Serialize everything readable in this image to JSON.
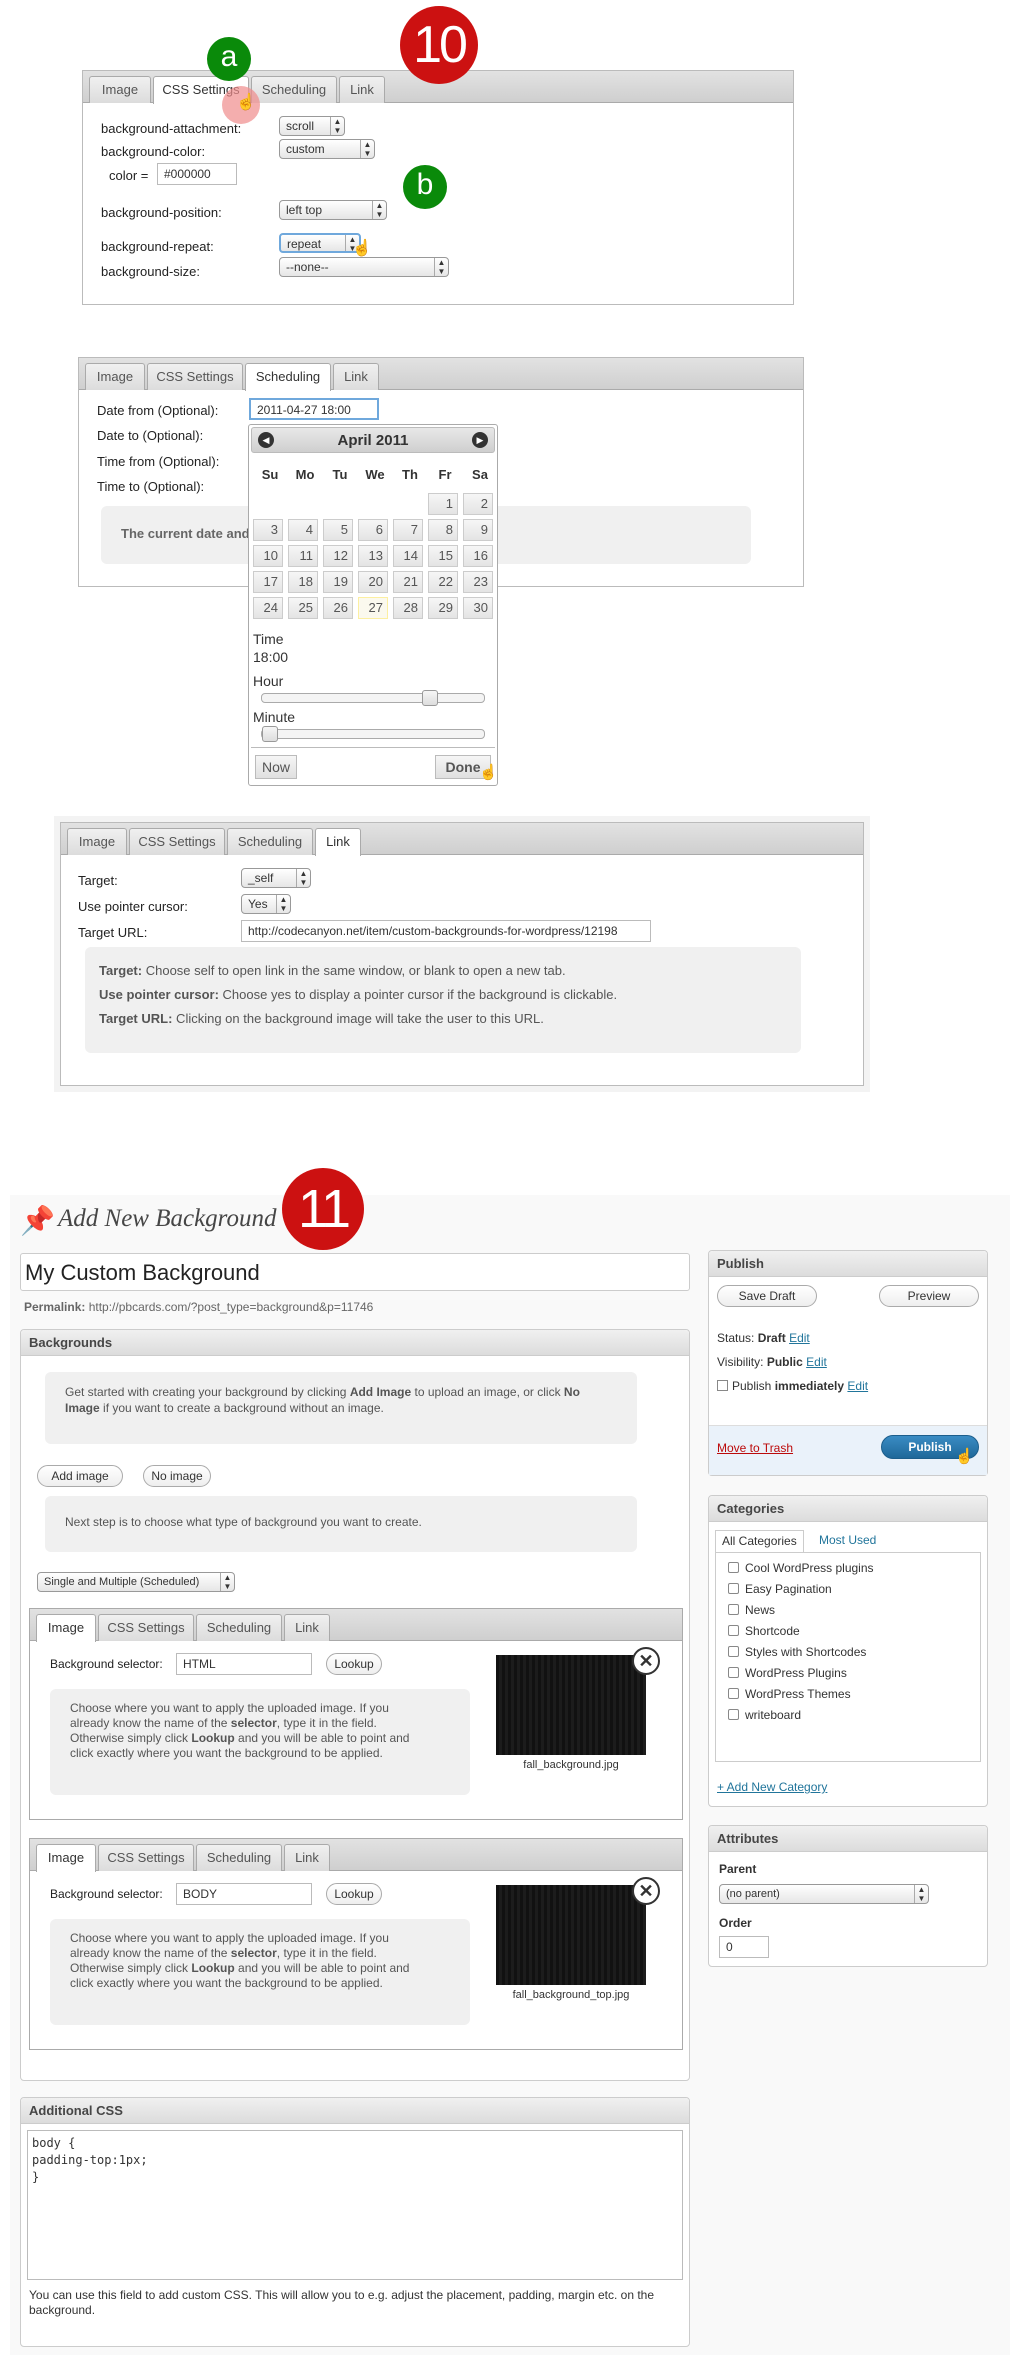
{
  "callouts": {
    "s10": "10",
    "a": "a",
    "b": "b",
    "s11": "11"
  },
  "tabs": [
    "Image",
    "CSS Settings",
    "Scheduling",
    "Link"
  ],
  "css_panel": {
    "labels": [
      "background-attachment:",
      "background-color:",
      "color =",
      "background-position:",
      "background-repeat:",
      "background-size:"
    ],
    "attachment": "scroll",
    "color_select": "custom",
    "color_value": "#000000",
    "position": "left top",
    "repeat": "repeat",
    "size": "--none--"
  },
  "schedule_panel": {
    "labels": [
      "Date from (Optional):",
      "Date to (Optional):",
      "Time from (Optional):",
      "Time to (Optional):"
    ],
    "date_from": "2011-04-27 18:00",
    "info": "The current date and"
  },
  "datepicker": {
    "month": "April 2011",
    "dow": [
      "Su",
      "Mo",
      "Tu",
      "We",
      "Th",
      "Fr",
      "Sa"
    ],
    "weeks": [
      [
        "",
        "",
        "",
        "",
        "",
        "1",
        "2"
      ],
      [
        "3",
        "4",
        "5",
        "6",
        "7",
        "8",
        "9"
      ],
      [
        "10",
        "11",
        "12",
        "13",
        "14",
        "15",
        "16"
      ],
      [
        "17",
        "18",
        "19",
        "20",
        "21",
        "22",
        "23"
      ],
      [
        "24",
        "25",
        "26",
        "27",
        "28",
        "29",
        "30"
      ]
    ],
    "selected_day": "27",
    "time_label": "Time",
    "time_value": "18:00",
    "hour_label": "Hour",
    "minute_label": "Minute",
    "hour_fraction": 0.77,
    "minute_fraction": 0.0,
    "now": "Now",
    "done": "Done"
  },
  "link_panel": {
    "labels": [
      "Target:",
      "Use pointer cursor:",
      "Target URL:"
    ],
    "target": "_self",
    "pointer": "Yes",
    "url": "http://codecanyon.net/item/custom-backgrounds-for-wordpress/12198",
    "help": [
      {
        "b": "Target:",
        "t": " Choose self to open link in the same window, or blank to open a new tab."
      },
      {
        "b": "Use pointer cursor:",
        "t": " Choose yes to display a pointer cursor if the background is clickable."
      },
      {
        "b": "Target URL:",
        "t": " Clicking on the background image will take the user to this URL."
      }
    ]
  },
  "editor": {
    "heading": "Add New Background",
    "title_value": "My Custom Background",
    "permalink_label": "Permalink:",
    "permalink": "http://pbcards.com/?post_type=background&p=11746",
    "backgrounds_heading": "Backgrounds",
    "intro_1": "Get started with creating your background by clicking ",
    "intro_b1": "Add Image",
    "intro_2": " to upload an image, or click ",
    "intro_b2": "No",
    "intro_b3": "Image",
    "intro_3": " if you want to create a background without an image.",
    "add_image": "Add image",
    "no_image": "No image",
    "next_step": "Next step is to choose what type of background you want to create.",
    "type_select": "Single and Multiple (Scheduled)",
    "items": [
      {
        "selector_label": "Background selector:",
        "selector": "HTML",
        "lookup": "Lookup",
        "filename": "fall_background.jpg"
      },
      {
        "selector_label": "Background selector:",
        "selector": "BODY",
        "lookup": "Lookup",
        "filename": "fall_background_top.jpg"
      }
    ],
    "help_lines": [
      "Choose where you want to apply the uploaded image. If you",
      "already know the name of the ",
      "selector",
      ", type it in the field.",
      "Otherwise simply click ",
      "Lookup",
      " and you will be able to point and",
      "click exactly where you want the background to be applied."
    ],
    "additional_css_heading": "Additional CSS",
    "css_lines": [
      "body {",
      "padding-top:1px;",
      "}"
    ],
    "css_help": "You can use this field to add custom CSS. This will allow you to e.g. adjust the placement, padding, margin etc. on the background."
  },
  "publish": {
    "heading": "Publish",
    "save_draft": "Save Draft",
    "preview": "Preview",
    "status_label": "Status:",
    "status_value": "Draft",
    "visibility_label": "Visibility:",
    "visibility_value": "Public",
    "publish_label": "Publish",
    "publish_value": "immediately",
    "edit": "Edit",
    "trash": "Move to Trash",
    "publish_button": "Publish"
  },
  "categories": {
    "heading": "Categories",
    "tab_all": "All Categories",
    "tab_used": "Most Used",
    "items": [
      "Cool WordPress plugins",
      "Easy Pagination",
      "News",
      "Shortcode",
      "Styles with Shortcodes",
      "WordPress Plugins",
      "WordPress Themes",
      "writeboard"
    ],
    "add_new": "+ Add New Category"
  },
  "attributes": {
    "heading": "Attributes",
    "parent_label": "Parent",
    "parent_value": "(no parent)",
    "order_label": "Order",
    "order_value": "0"
  },
  "colors": {
    "red": "#cc1111",
    "green": "#0a8a0a",
    "publish_blue": "#2a7ab0",
    "link": "#21759b",
    "trash": "#bc0b0b"
  }
}
